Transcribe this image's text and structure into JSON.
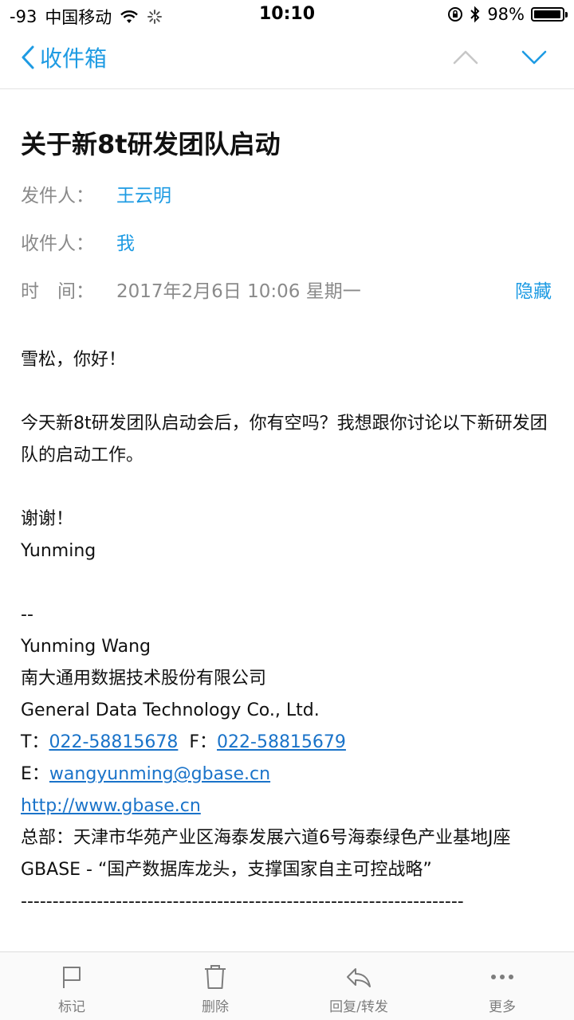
{
  "status_bar": {
    "signal": "-93",
    "carrier": "中国移动",
    "time": "10:10",
    "battery": "98%",
    "battery_level": 0.98
  },
  "nav": {
    "back_label": "收件箱"
  },
  "email": {
    "subject": "关于新8t研发团队启动",
    "from_label": "发件人：",
    "from_value": "王云明",
    "to_label": "收件人：",
    "to_value": "我",
    "time_label": "时　间：",
    "time_value": "2017年2月6日 10:06 星期一",
    "hide_label": "隐藏"
  },
  "body": {
    "greeting": "雪松，你好！",
    "paragraph1": "今天新8t研发团队启动会后，你有空吗？我想跟你讨论以下新研发团队的启动工作。",
    "thanks": "谢谢！",
    "sign_short": "Yunming",
    "sig_sep": "--",
    "sig_name": "Yunming Wang",
    "sig_company_cn": "南大通用数据技术股份有限公司",
    "sig_company_en": "General Data Technology Co., Ltd.",
    "tel_label": "T：",
    "tel_value": "022-58815678",
    "fax_label": "F：",
    "fax_value": "022-58815679",
    "email_label": "E：",
    "email_value": "wangyunming@gbase.cn",
    "website": "http://www.gbase.cn",
    "address": "总部：天津市华苑产业区海泰发展六道6号海泰绿色产业基地J座",
    "slogan": "GBASE - “国产数据库龙头，支撑国家自主可控战略”",
    "divider": "----------------------------------------------------------------------"
  },
  "toolbar": {
    "flag_label": "标记",
    "delete_label": "删除",
    "reply_label": "回复/转发",
    "more_label": "更多"
  },
  "colors": {
    "accent": "#1e9be3",
    "link": "#1a73c9",
    "meta_gray": "#8a8a8a"
  }
}
